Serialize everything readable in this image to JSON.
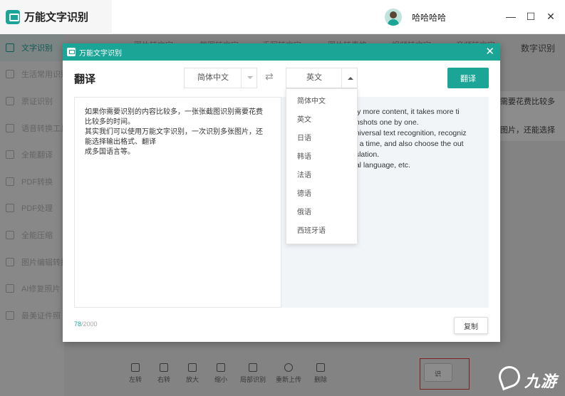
{
  "app": {
    "name": "万能文字识别",
    "user": "哈哈哈哈"
  },
  "window_controls": {
    "minimize": "—",
    "maximize": "☐",
    "close": "✕"
  },
  "sidebar": {
    "items": [
      {
        "label": "文字识别",
        "active": true
      },
      {
        "label": "生活常用识别"
      },
      {
        "label": "票证识别"
      },
      {
        "label": "语音转换工具"
      },
      {
        "label": "全能翻译"
      },
      {
        "label": "PDF转换"
      },
      {
        "label": "PDF处理"
      },
      {
        "label": "全能压缩"
      },
      {
        "label": "图片编辑转换"
      },
      {
        "label": "AI修复照片"
      },
      {
        "label": "最美证件照"
      }
    ]
  },
  "top_tabs": [
    "图片转文字",
    "截图转文字",
    "手写转文字",
    "图片转表格",
    "视频转文字",
    "音频转文字",
    "数字识别"
  ],
  "bg_right_text": {
    "line1": "需要花费比较多",
    "line2": "图片，还能选择"
  },
  "toolbar": [
    "左转",
    "右转",
    "放大",
    "缩小",
    "局部识别",
    "重新上传",
    "删除"
  ],
  "redbox_label": "识",
  "watermark": {
    "text": "九游"
  },
  "modal": {
    "header_title": "万能文字识别",
    "close_icon": "✕",
    "title": "翻译",
    "source_lang": "简体中文",
    "target_lang": "英文",
    "swap_icon": "⇄",
    "translate_button": "翻译",
    "source_lines": [
      "如果你需要识别的内容比较多，一张张截图识别需要花费",
      "比较多的时间。",
      "其实我们可以使用万能文字识别，一次识别多张图片，还",
      "能选择输出格式、翻译",
      "成多国语言等。"
    ],
    "target_lines": [
      "tify more content, it takes more ti",
      "enshots one by one.",
      "universal text recognition, recogniz",
      "at a time, and also choose the out",
      "nslation.",
      "ual language, etc."
    ],
    "char_count": "78",
    "char_total": "/2000",
    "copy_button": "复制",
    "dropdown_options": [
      "简体中文",
      "英文",
      "日语",
      "韩语",
      "法语",
      "德语",
      "俄语",
      "西班牙语"
    ]
  },
  "colors": {
    "accent": "#1aa597",
    "highlight": "#e0443b"
  }
}
